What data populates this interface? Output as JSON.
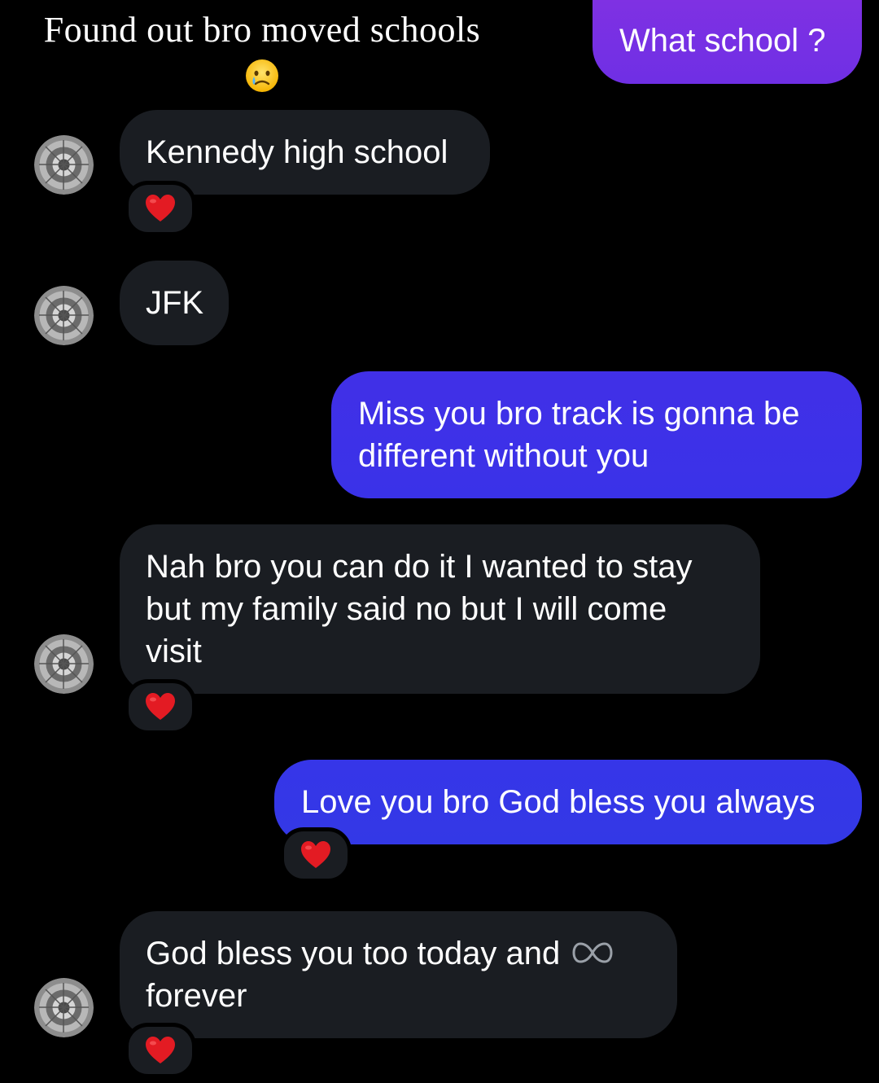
{
  "overlay": {
    "caption": "Found out bro moved schools"
  },
  "messages": [
    {
      "sender": "me",
      "text": "What school ?"
    },
    {
      "sender": "friend",
      "text": "Kennedy high school",
      "reaction": "heart"
    },
    {
      "sender": "friend",
      "text": "JFK"
    },
    {
      "sender": "me",
      "lines": [
        "Miss you bro track is gonna be",
        "different without you"
      ]
    },
    {
      "sender": "friend",
      "lines": [
        "Nah bro you can do it I wanted to stay",
        "but my family said no but I will come",
        "visit"
      ],
      "reaction": "heart"
    },
    {
      "sender": "me",
      "text": "Love you bro God bless you always",
      "reaction": "heart"
    },
    {
      "sender": "friend",
      "lines": [
        "God bless you too today and",
        "forever"
      ],
      "inline_icon": "infinity-icon",
      "reaction": "heart"
    }
  ],
  "colors": {
    "background": "#000000",
    "incoming_bubble": "#1a1d22",
    "outgoing_top": "#7a2fe0",
    "outgoing_mid": "#3c2fe8",
    "outgoing_bottom": "#3337e6",
    "heart": "#e31b23"
  }
}
